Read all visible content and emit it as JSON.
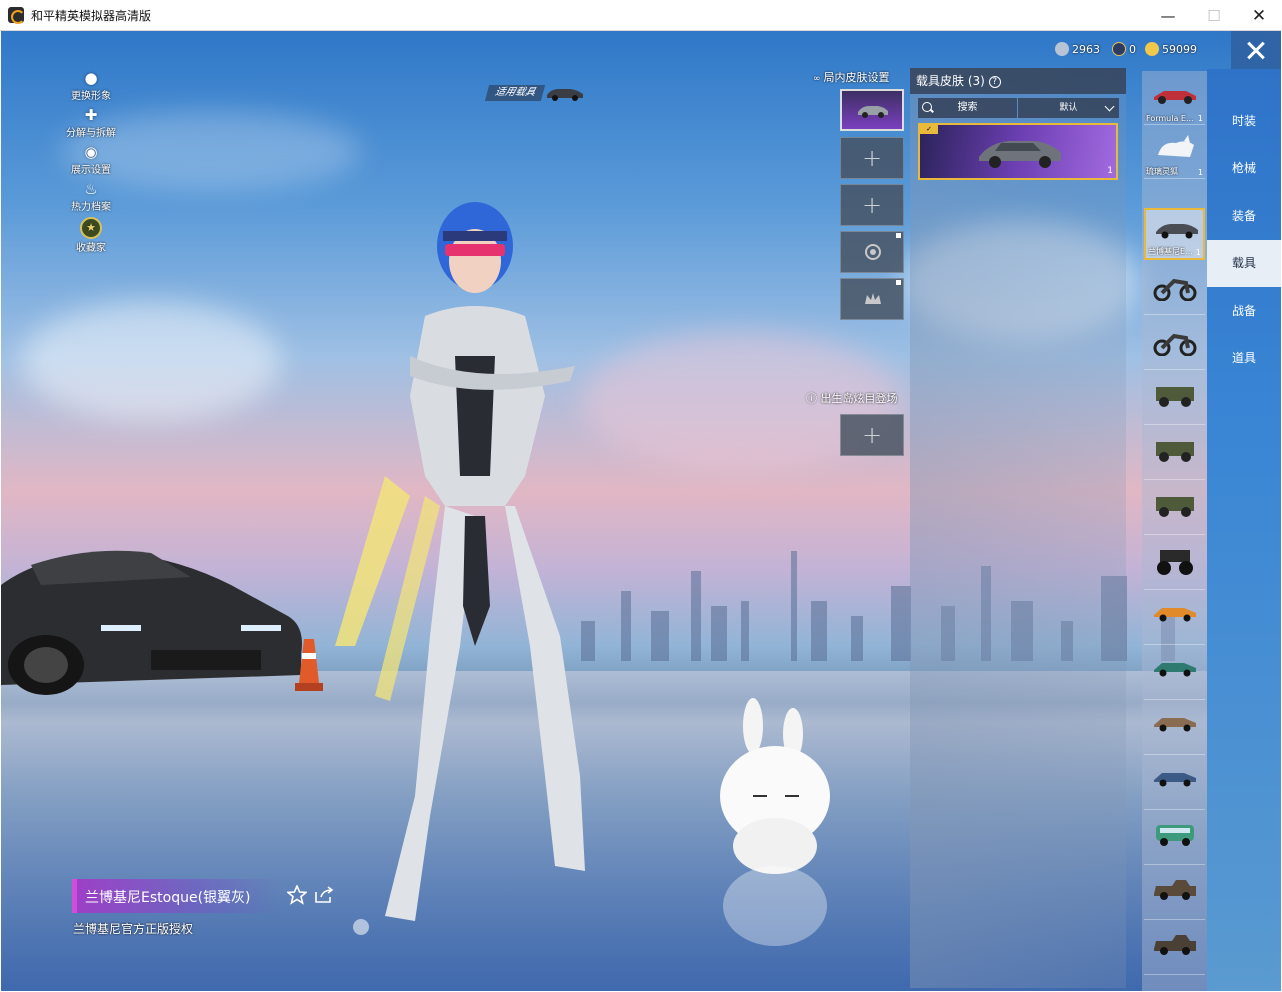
{
  "window": {
    "title": "和平精英模拟器高清版",
    "minimize": "—",
    "maximize": "☐",
    "close": "✕"
  },
  "currency": {
    "c1": "2963",
    "c2": "0",
    "c3": "59099"
  },
  "left_menu": [
    {
      "label": "更换形象",
      "icon": "person-icon"
    },
    {
      "label": "分解与拆解",
      "icon": "puzzle-icon"
    },
    {
      "label": "展示设置",
      "icon": "eye-icon"
    },
    {
      "label": "热力档案",
      "icon": "flame-icon"
    },
    {
      "label": "收藏家",
      "icon": "collector-badge-icon"
    }
  ],
  "vehicle_tag": "适用载具",
  "settings": {
    "in_match_title": "局内皮肤设置",
    "birth_island_title": "出生岛炫目登场"
  },
  "skin_panel": {
    "title": "载具皮肤",
    "count": "(3)",
    "search_label": "搜索",
    "sort_label": "默认",
    "card_count": "1"
  },
  "vehicles": [
    {
      "name": "Formula E...",
      "count": "1"
    },
    {
      "name": "琉璃灵狐",
      "count": "1"
    },
    {
      "name": "兰博基尼E...",
      "count": "1"
    },
    {
      "name": "",
      "count": ""
    },
    {
      "name": "",
      "count": ""
    },
    {
      "name": "",
      "count": ""
    },
    {
      "name": "",
      "count": ""
    },
    {
      "name": "",
      "count": ""
    },
    {
      "name": "",
      "count": ""
    },
    {
      "name": "",
      "count": ""
    },
    {
      "name": "",
      "count": ""
    },
    {
      "name": "",
      "count": ""
    },
    {
      "name": "",
      "count": ""
    },
    {
      "name": "",
      "count": ""
    },
    {
      "name": "",
      "count": ""
    }
  ],
  "tabs": [
    "时装",
    "枪械",
    "装备",
    "载具",
    "战备",
    "道具"
  ],
  "active_tab": "载具",
  "item": {
    "title": "兰博基尼Estoque(银翼灰)",
    "subtitle": "兰博基尼官方正版授权"
  },
  "colors": {
    "accent_gold": "#e9b93b",
    "rarity_purple": "#7b3fbf",
    "tab_blue": "#2f73c8"
  }
}
